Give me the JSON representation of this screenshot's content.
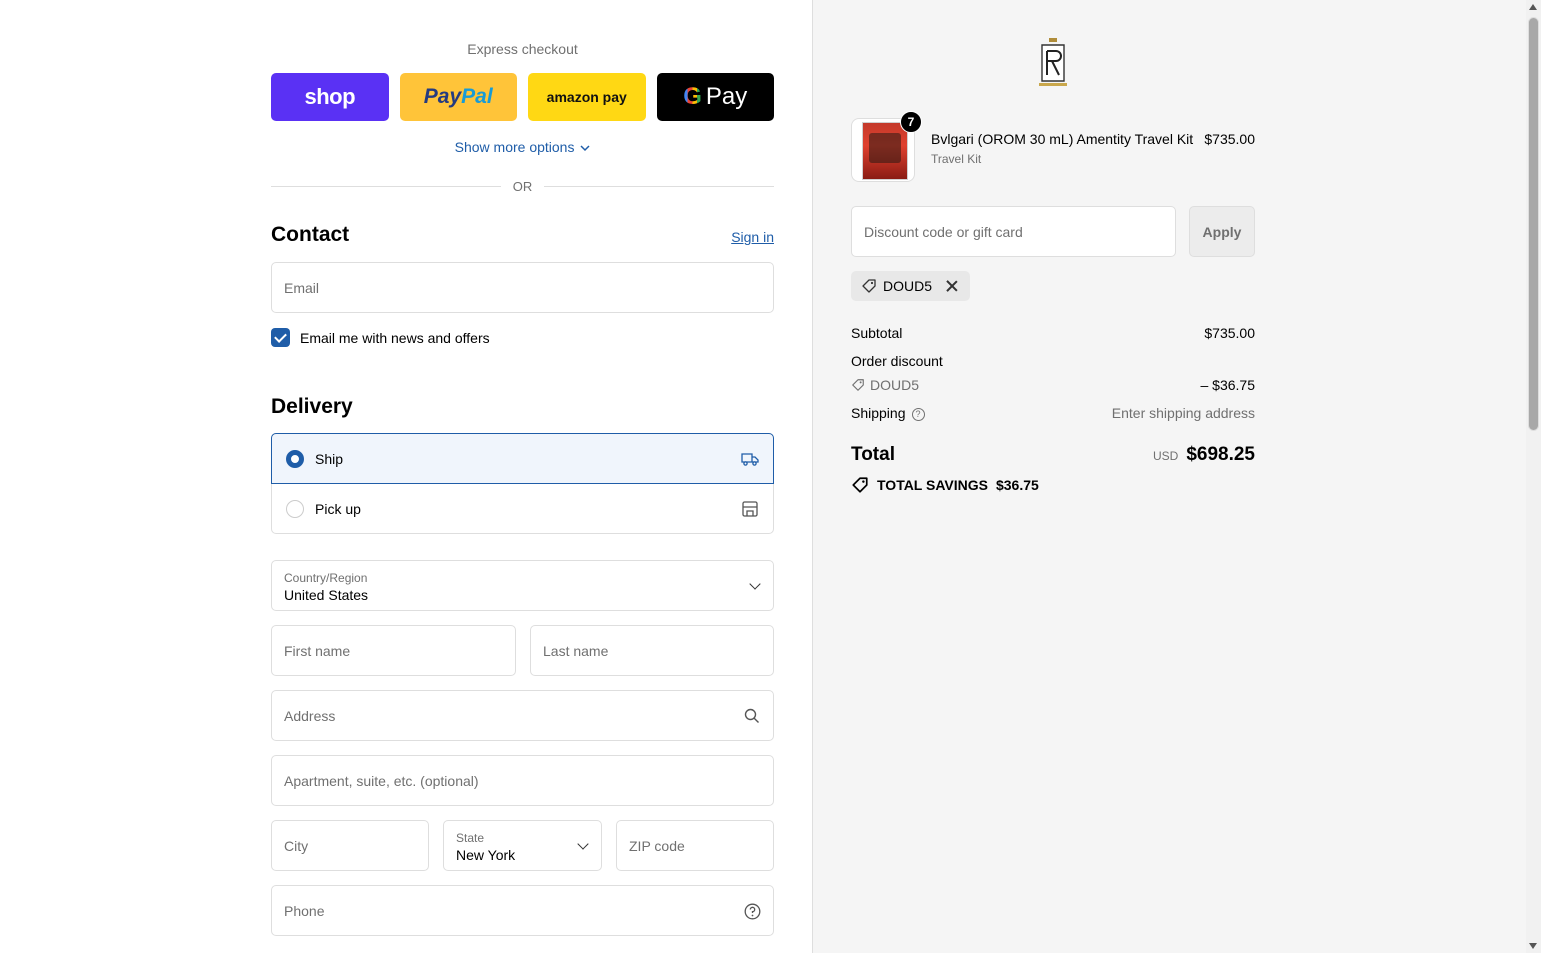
{
  "express": {
    "title": "Express checkout",
    "buttons": {
      "shop": "shop",
      "paypal_a": "Pay",
      "paypal_b": "Pal",
      "amazon": "amazon pay",
      "gpay_g": "G",
      "gpay_text": "Pay"
    },
    "show_more": "Show more options",
    "or_label": "OR"
  },
  "contact": {
    "heading": "Contact",
    "sign_in": "Sign in",
    "email_placeholder": "Email",
    "newsletter_label": "Email me with news and offers",
    "newsletter_checked": true
  },
  "delivery": {
    "heading": "Delivery",
    "options": [
      {
        "label": "Ship",
        "selected": true,
        "icon": "truck-icon"
      },
      {
        "label": "Pick up",
        "selected": false,
        "icon": "store-icon"
      }
    ],
    "country_label": "Country/Region",
    "country_value": "United States",
    "first_name_placeholder": "First name",
    "last_name_placeholder": "Last name",
    "address_placeholder": "Address",
    "apartment_placeholder": "Apartment, suite, etc. (optional)",
    "city_placeholder": "City",
    "state_label": "State",
    "state_value": "New York",
    "zip_placeholder": "ZIP code",
    "phone_placeholder": "Phone"
  },
  "summary": {
    "item": {
      "name": "Bvlgari (OROM 30 mL) Amentity Travel Kit",
      "variant": "Travel Kit",
      "price": "$735.00",
      "quantity": "7"
    },
    "discount_placeholder": "Discount code or gift card",
    "apply_label": "Apply",
    "applied_code": "DOUD5",
    "subtotal_label": "Subtotal",
    "subtotal_value": "$735.00",
    "order_discount_label": "Order discount",
    "discount_code": "DOUD5",
    "discount_value": "– $36.75",
    "shipping_label": "Shipping",
    "shipping_value": "Enter shipping address",
    "total_label": "Total",
    "currency": "USD",
    "total_value": "$698.25",
    "savings_label": "TOTAL SAVINGS",
    "savings_value": "$36.75"
  },
  "colors": {
    "accent": "#1f5da8",
    "shop_purple": "#5a31f4",
    "paypal_yellow": "#ffc439",
    "amazon_yellow": "#ffd814"
  }
}
